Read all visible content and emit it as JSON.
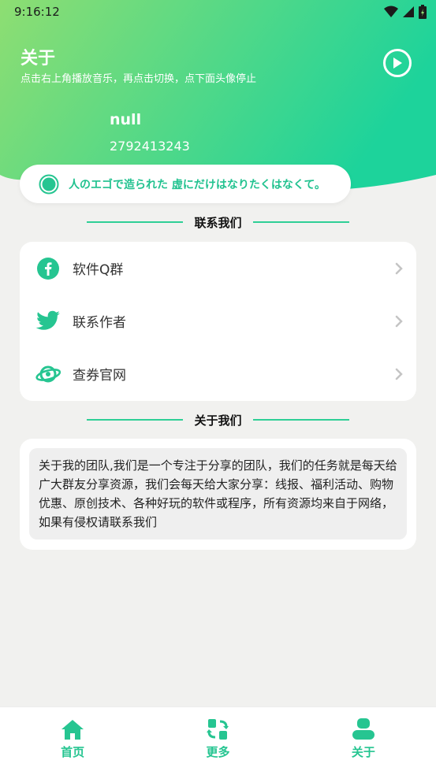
{
  "statusbar": {
    "time": "9:16:12"
  },
  "header": {
    "title": "关于",
    "subtitle": "点击右上角播放音乐，再点击切换，点下面头像停止",
    "username": "null",
    "qq": "2792413243"
  },
  "quote": {
    "text": "人のエゴで造られた 虚にだけはなりたくはなくて。"
  },
  "contact_section": {
    "title": "联系我们",
    "items": [
      {
        "label": "软件Q群",
        "icon": "facebook-icon"
      },
      {
        "label": "联系作者",
        "icon": "twitter-icon"
      },
      {
        "label": "查券官网",
        "icon": "planet-icon"
      }
    ]
  },
  "about_section": {
    "title": "关于我们",
    "text": "关于我的团队,我们是一个专注于分享的团队，我们的任务就是每天给广大群友分享资源，我们会每天给大家分享：线报、福利活动、购物优惠、原创技术、各种好玩的软件或程序，所有资源均来自于网络，如果有侵权请联系我们"
  },
  "nav": {
    "items": [
      {
        "label": "首页",
        "icon": "home-icon"
      },
      {
        "label": "更多",
        "icon": "more-icon"
      },
      {
        "label": "关于",
        "icon": "user-icon"
      }
    ]
  },
  "colors": {
    "accent": "#26c591",
    "gradient_start": "#8ede72",
    "gradient_end": "#1dd39b",
    "background": "#f1f1ef"
  }
}
